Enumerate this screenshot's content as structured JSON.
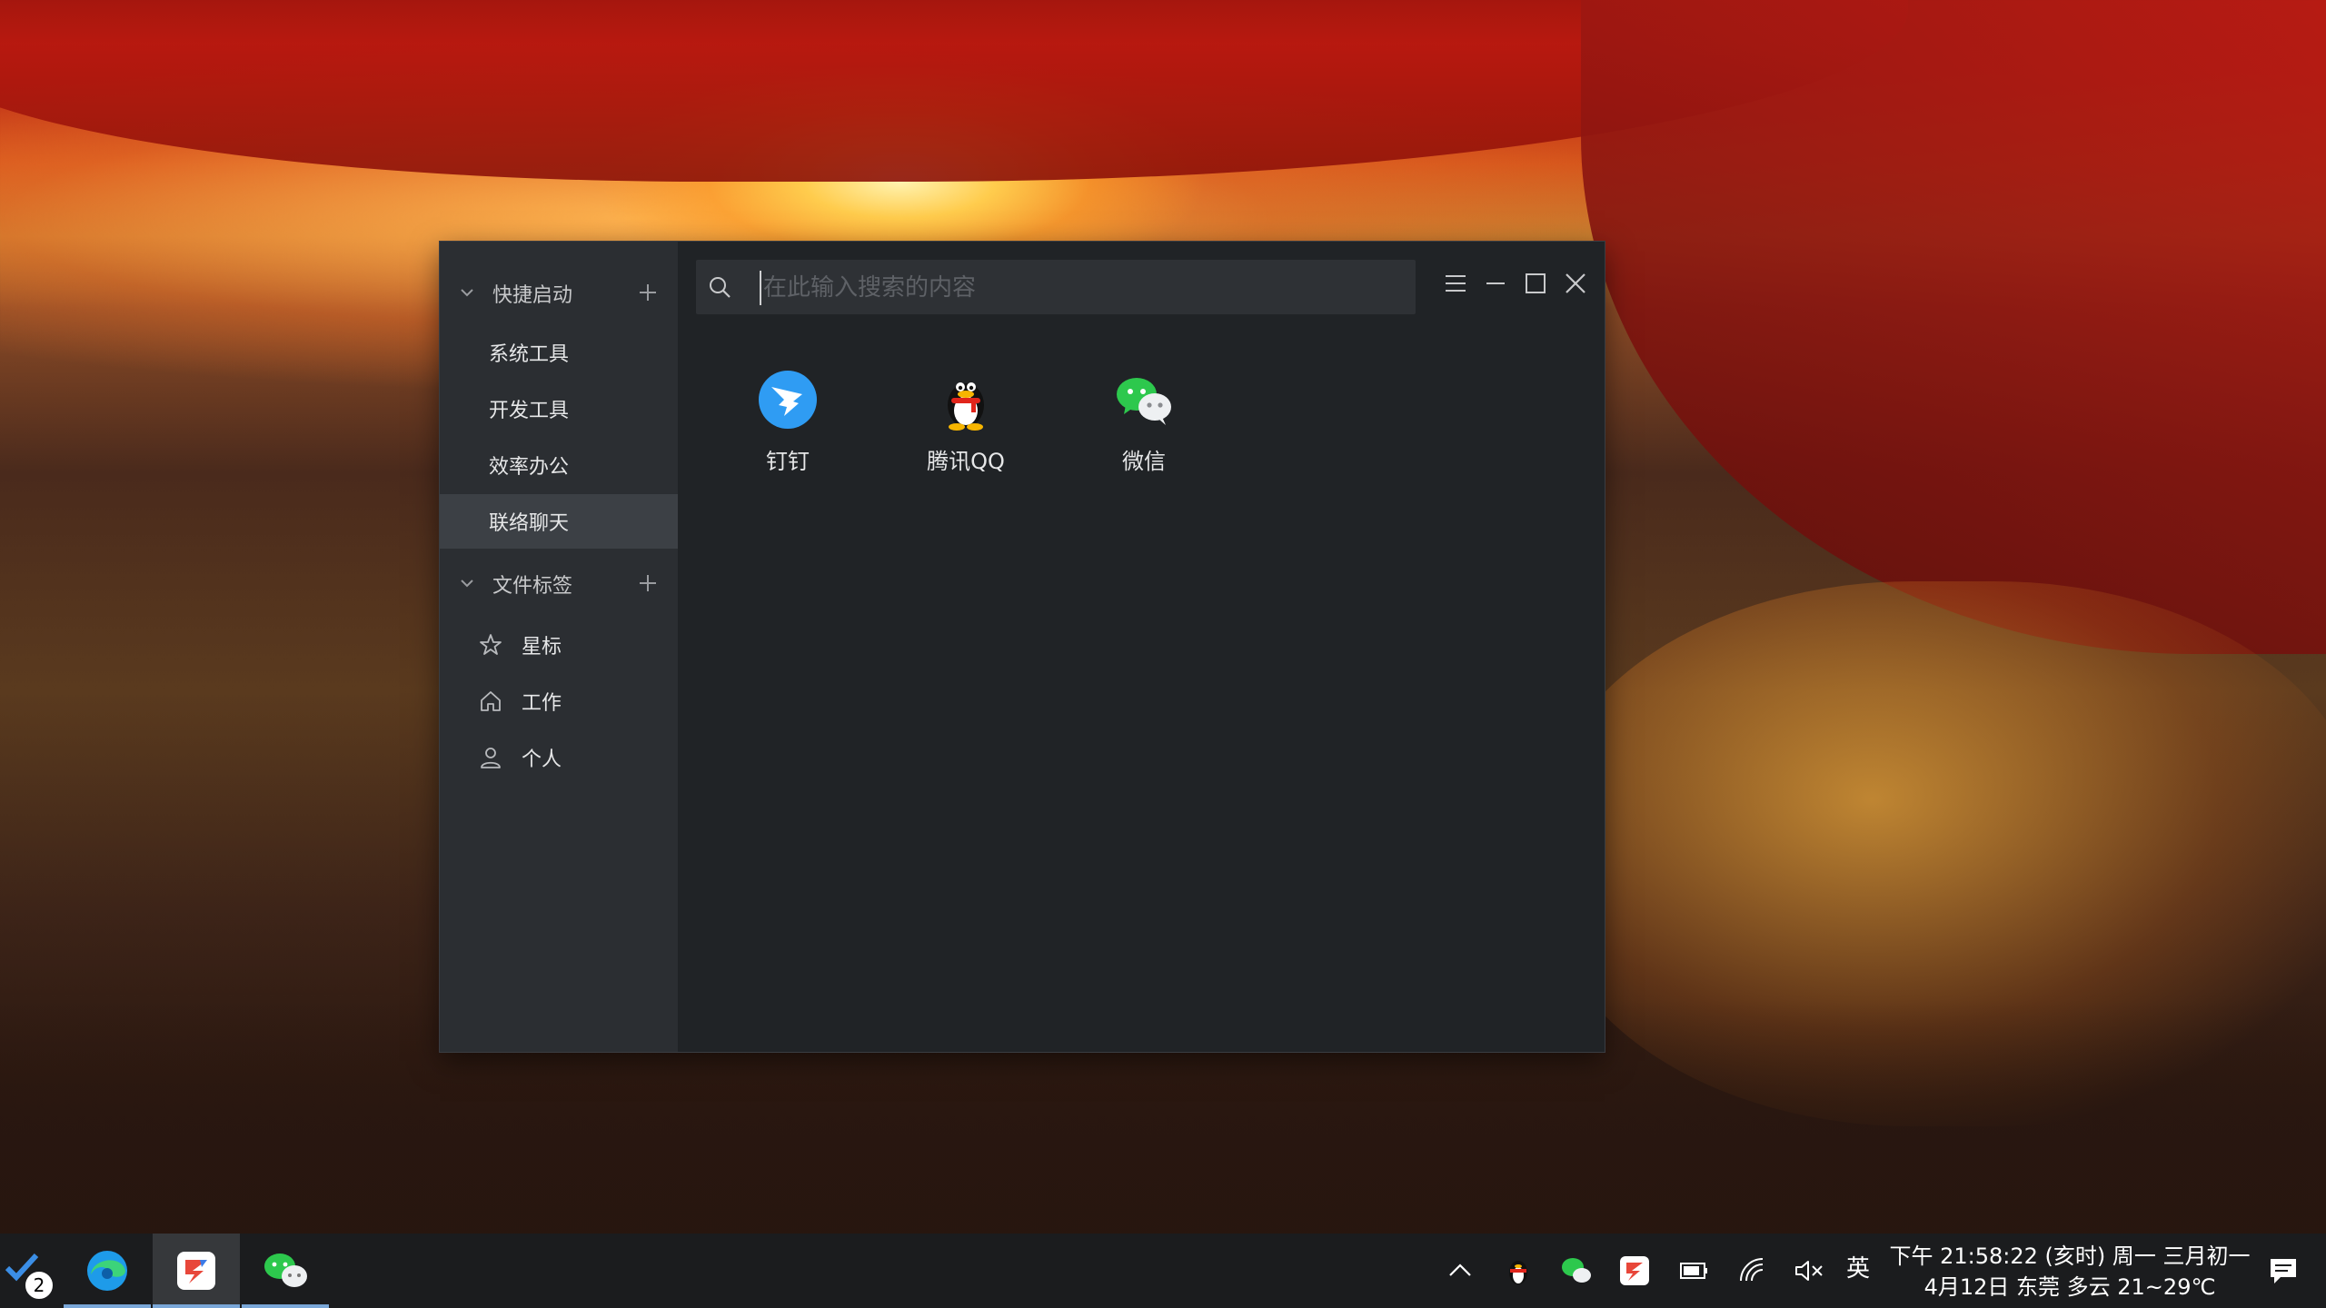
{
  "sidebar": {
    "quick_launch": {
      "label": "快捷启动"
    },
    "items": [
      {
        "label": "系统工具"
      },
      {
        "label": "开发工具"
      },
      {
        "label": "效率办公"
      },
      {
        "label": "联络聊天"
      }
    ],
    "file_tags": {
      "label": "文件标签"
    },
    "tags": [
      {
        "label": "星标",
        "icon": "star-icon"
      },
      {
        "label": "工作",
        "icon": "home-icon"
      },
      {
        "label": "个人",
        "icon": "person-icon"
      }
    ]
  },
  "search": {
    "placeholder": "在此输入搜索的内容",
    "value": ""
  },
  "apps": [
    {
      "name": "钉钉",
      "icon": "dingtalk-icon"
    },
    {
      "name": "腾讯QQ",
      "icon": "qq-icon"
    },
    {
      "name": "微信",
      "icon": "wechat-icon"
    }
  ],
  "taskbar": {
    "todo_badge": "2",
    "ime": "英",
    "clock_line1": "下午 21:58:22 (亥时) 周一 三月初一",
    "clock_line2": "4月12日 东莞 多云 21~29℃"
  },
  "colors": {
    "accent": "#7aa7d8",
    "sidebar_bg": "#2b2e32",
    "window_bg": "#202326",
    "active_item": "#3c4045"
  }
}
